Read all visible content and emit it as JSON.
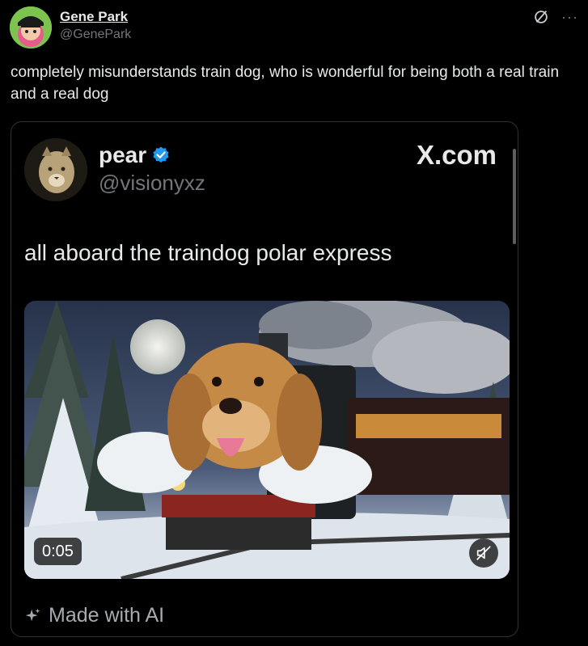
{
  "post": {
    "author": {
      "display_name": "Gene Park",
      "handle": "@GenePark"
    },
    "icons": {
      "link": "link-broken-icon",
      "more": "more-horizontal-icon",
      "more_glyph": "···"
    },
    "text": "completely misunderstands train dog, who is wonderful for being both a real train and a real dog"
  },
  "embed": {
    "author": {
      "display_name": "pear",
      "handle": "@visionyxz",
      "verified": true
    },
    "source": "X.com",
    "text": "all aboard the traindog polar express",
    "media": {
      "duration": "0:05",
      "muted": true
    },
    "ai_label": "Made with AI"
  },
  "colors": {
    "background": "#000000",
    "text": "#e7e9ea",
    "secondary": "#71767b",
    "verified": "#1d9bf0",
    "border": "#2f3336"
  }
}
